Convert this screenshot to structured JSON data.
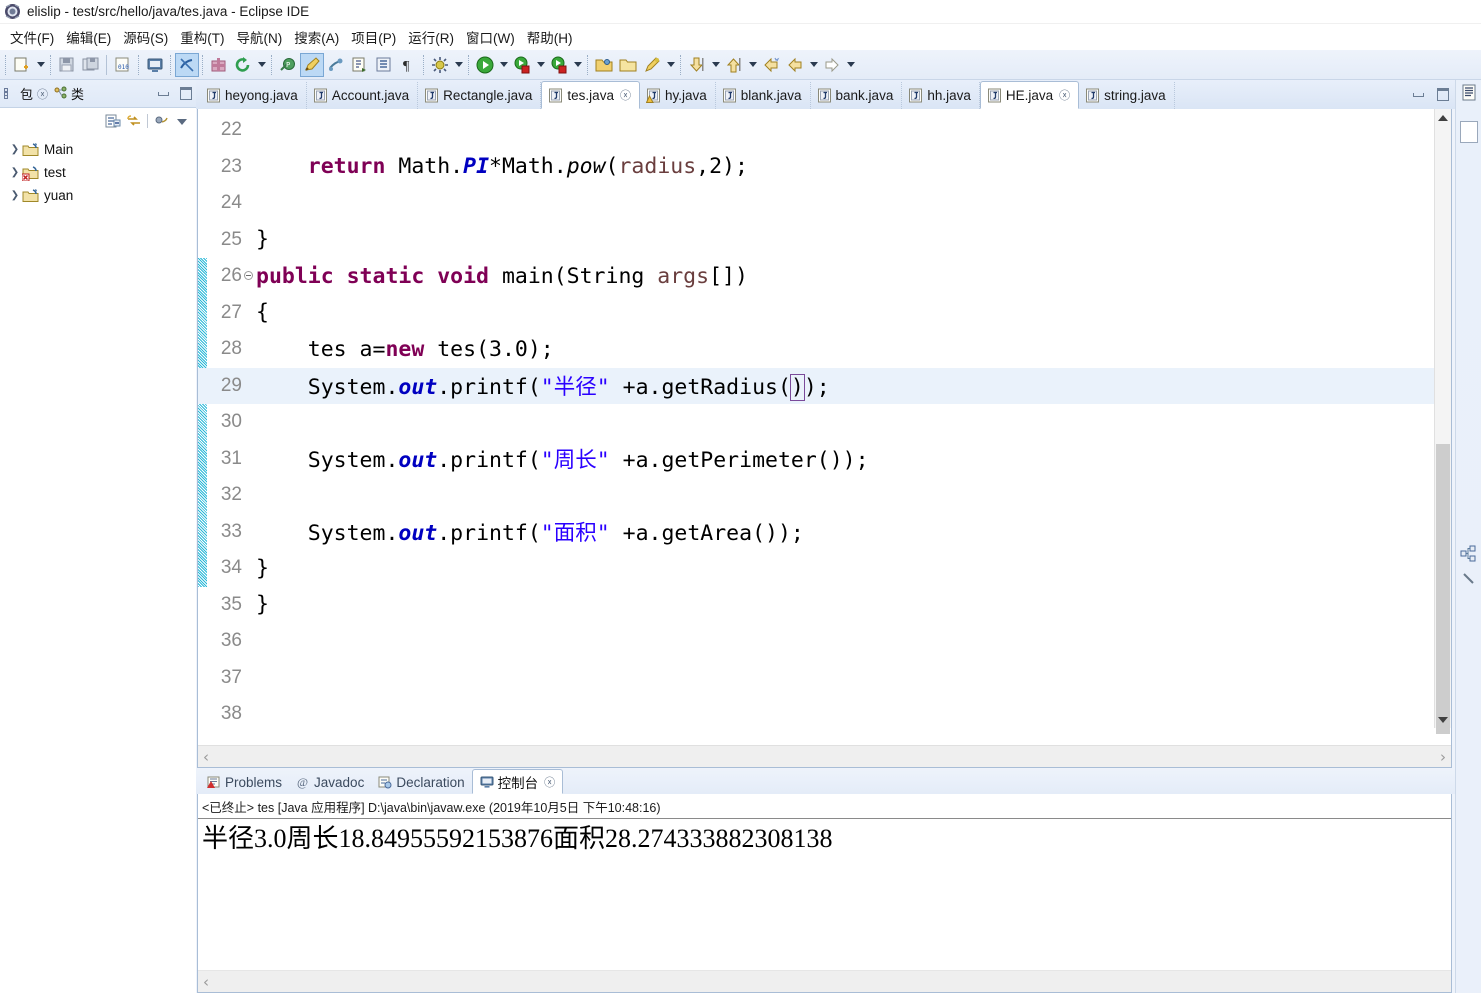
{
  "window": {
    "title": "elislip - test/src/hello/java/tes.java - Eclipse IDE",
    "icon": "eclipse-icon"
  },
  "menubar": {
    "items": [
      {
        "label": "文件(F)",
        "name": "menu-file"
      },
      {
        "label": "编辑(E)",
        "name": "menu-edit"
      },
      {
        "label": "源码(S)",
        "name": "menu-source"
      },
      {
        "label": "重构(T)",
        "name": "menu-refactor"
      },
      {
        "label": "导航(N)",
        "name": "menu-navigate"
      },
      {
        "label": "搜索(A)",
        "name": "menu-search"
      },
      {
        "label": "项目(P)",
        "name": "menu-project"
      },
      {
        "label": "运行(R)",
        "name": "menu-run"
      },
      {
        "label": "窗口(W)",
        "name": "menu-window"
      },
      {
        "label": "帮助(H)",
        "name": "menu-help"
      }
    ]
  },
  "toolbar": {
    "icons": [
      "new-file-icon",
      "save-icon",
      "save-all-icon",
      "print-icon",
      "toggle-console-icon",
      "toggle-breakpoint-icon",
      "new-package-icon",
      "refresh-icon",
      "toggle-mark-occurrences-icon",
      "pencil-icon",
      "link-editor-icon",
      "open-type-icon",
      "open-task-icon",
      "pilcrow-icon",
      "debug-icon",
      "run-icon",
      "run-coverage-icon",
      "run-external-icon",
      "open-folder-icon",
      "new-folder-icon",
      "search-icon",
      "next-annotation-icon",
      "previous-annotation-icon",
      "back-icon",
      "forward-left-icon",
      "forward-right-icon"
    ]
  },
  "sidebar": {
    "tabs": [
      {
        "label": "包",
        "name": "tab-package-explorer",
        "icon": "package-icon",
        "active": true,
        "closable": true
      },
      {
        "label": "类",
        "name": "tab-type-hierarchy",
        "icon": "hierarchy-icon",
        "active": false,
        "closable": false
      }
    ],
    "toolbar_icons": [
      "collapse-all-icon",
      "link-with-editor-icon",
      "focus-icon",
      "view-menu-icon"
    ],
    "window_buttons": [
      "minimize-icon",
      "maximize-icon"
    ],
    "tree": [
      {
        "label": "Main",
        "icon": "java-project-icon",
        "expanded": false,
        "error": false
      },
      {
        "label": "test",
        "icon": "java-project-icon",
        "expanded": false,
        "error": true
      },
      {
        "label": "yuan",
        "icon": "java-project-icon",
        "expanded": false,
        "error": false
      }
    ]
  },
  "editor": {
    "tabs": [
      {
        "label": "heyong.java",
        "active": false,
        "closable": false,
        "icon": "java-file-icon"
      },
      {
        "label": "Account.java",
        "active": false,
        "closable": false,
        "icon": "java-file-icon"
      },
      {
        "label": "Rectangle.java",
        "active": false,
        "closable": false,
        "icon": "java-file-icon"
      },
      {
        "label": "tes.java",
        "active": true,
        "closable": true,
        "icon": "java-file-icon"
      },
      {
        "label": "hy.java",
        "active": false,
        "closable": false,
        "icon": "java-file-warning-icon"
      },
      {
        "label": "blank.java",
        "active": false,
        "closable": false,
        "icon": "java-file-icon"
      },
      {
        "label": "bank.java",
        "active": false,
        "closable": false,
        "icon": "java-file-icon"
      },
      {
        "label": "hh.java",
        "active": false,
        "closable": false,
        "icon": "java-file-icon"
      },
      {
        "label": "HE.java",
        "active": true,
        "closable": true,
        "icon": "java-file-icon"
      },
      {
        "label": "string.java",
        "active": false,
        "closable": false,
        "icon": "java-file-icon"
      }
    ],
    "window_buttons": [
      "minimize-icon",
      "maximize-icon"
    ],
    "current_line": 29,
    "scroll": {
      "horizontal_left": "‹",
      "horizontal_right": "›"
    },
    "lines": [
      {
        "n": "22",
        "fold": false,
        "marker": false,
        "tokens": []
      },
      {
        "n": "23",
        "fold": false,
        "marker": false,
        "tokens": [
          {
            "t": "    ",
            "c": ""
          },
          {
            "t": "return",
            "c": "kw"
          },
          {
            "t": " Math.",
            "c": ""
          },
          {
            "t": "PI",
            "c": "fld"
          },
          {
            "t": "*Math.",
            "c": ""
          },
          {
            "t": "pow",
            "c": "mth"
          },
          {
            "t": "(",
            "c": ""
          },
          {
            "t": "radius",
            "c": "prm"
          },
          {
            "t": ",2);",
            "c": ""
          }
        ]
      },
      {
        "n": "24",
        "fold": false,
        "marker": false,
        "tokens": []
      },
      {
        "n": "25",
        "fold": false,
        "marker": false,
        "tokens": [
          {
            "t": "}",
            "c": ""
          }
        ]
      },
      {
        "n": "26",
        "fold": true,
        "marker": true,
        "tokens": [
          {
            "t": "public static void ",
            "c": "kw"
          },
          {
            "t": "main(String ",
            "c": ""
          },
          {
            "t": "args",
            "c": "prm"
          },
          {
            "t": "[])",
            "c": ""
          }
        ]
      },
      {
        "n": "27",
        "fold": false,
        "marker": true,
        "tokens": [
          {
            "t": "{",
            "c": ""
          }
        ]
      },
      {
        "n": "28",
        "fold": false,
        "marker": true,
        "tokens": [
          {
            "t": "    tes a=",
            "c": ""
          },
          {
            "t": "new",
            "c": "kw"
          },
          {
            "t": " tes(3.0);",
            "c": ""
          }
        ]
      },
      {
        "n": "29",
        "fold": false,
        "marker": true,
        "tokens": [
          {
            "t": "    System.",
            "c": ""
          },
          {
            "t": "out",
            "c": "fld"
          },
          {
            "t": ".printf(",
            "c": ""
          },
          {
            "t": "\"半径\"",
            "c": "str"
          },
          {
            "t": " +a.getRadius(",
            "c": ""
          },
          {
            "t": ")",
            "c": "brk"
          },
          {
            "t": ");",
            "c": ""
          }
        ]
      },
      {
        "n": "30",
        "fold": false,
        "marker": true,
        "tokens": []
      },
      {
        "n": "31",
        "fold": false,
        "marker": true,
        "tokens": [
          {
            "t": "    System.",
            "c": ""
          },
          {
            "t": "out",
            "c": "fld"
          },
          {
            "t": ".printf(",
            "c": ""
          },
          {
            "t": "\"周长\"",
            "c": "str"
          },
          {
            "t": " +a.getPerimeter());",
            "c": ""
          }
        ]
      },
      {
        "n": "32",
        "fold": false,
        "marker": true,
        "tokens": []
      },
      {
        "n": "33",
        "fold": false,
        "marker": true,
        "tokens": [
          {
            "t": "    System.",
            "c": ""
          },
          {
            "t": "out",
            "c": "fld"
          },
          {
            "t": ".printf(",
            "c": ""
          },
          {
            "t": "\"面积\"",
            "c": "str"
          },
          {
            "t": " +a.getArea());",
            "c": ""
          }
        ]
      },
      {
        "n": "34",
        "fold": false,
        "marker": true,
        "tokens": [
          {
            "t": "}",
            "c": ""
          }
        ]
      },
      {
        "n": "35",
        "fold": false,
        "marker": false,
        "tokens": [
          {
            "t": "}",
            "c": ""
          }
        ]
      },
      {
        "n": "36",
        "fold": false,
        "marker": false,
        "tokens": []
      },
      {
        "n": "37",
        "fold": false,
        "marker": false,
        "tokens": []
      },
      {
        "n": "38",
        "fold": false,
        "marker": false,
        "tokens": []
      }
    ]
  },
  "console": {
    "tabs": [
      {
        "label": "Problems",
        "name": "tab-problems",
        "icon": "problems-icon",
        "active": false,
        "closable": false
      },
      {
        "label": "Javadoc",
        "name": "tab-javadoc",
        "icon": "javadoc-icon",
        "active": false,
        "closable": false
      },
      {
        "label": "Declaration",
        "name": "tab-declaration",
        "icon": "declaration-icon",
        "active": false,
        "closable": false
      },
      {
        "label": "控制台",
        "name": "tab-console",
        "icon": "console-icon",
        "active": true,
        "closable": true
      }
    ],
    "header": "<已终止> tes [Java 应用程序] D:\\java\\bin\\javaw.exe  (2019年10月5日 下午10:48:16)",
    "output": "半径3.0周长18.84955592153876面积28.274333882308138",
    "scroll_left": "‹"
  },
  "right_strip": {
    "items": [
      "outline-view-icon",
      "restore-view-box"
    ]
  },
  "colors": {
    "keyword": "#7F0055",
    "string": "#2A00FF",
    "field": "#0000C0",
    "parameter": "#6A3E3E",
    "current_line": "#EAF2FB",
    "chrome": "#E4ECF8",
    "marker_bar": "#29B8D8"
  }
}
